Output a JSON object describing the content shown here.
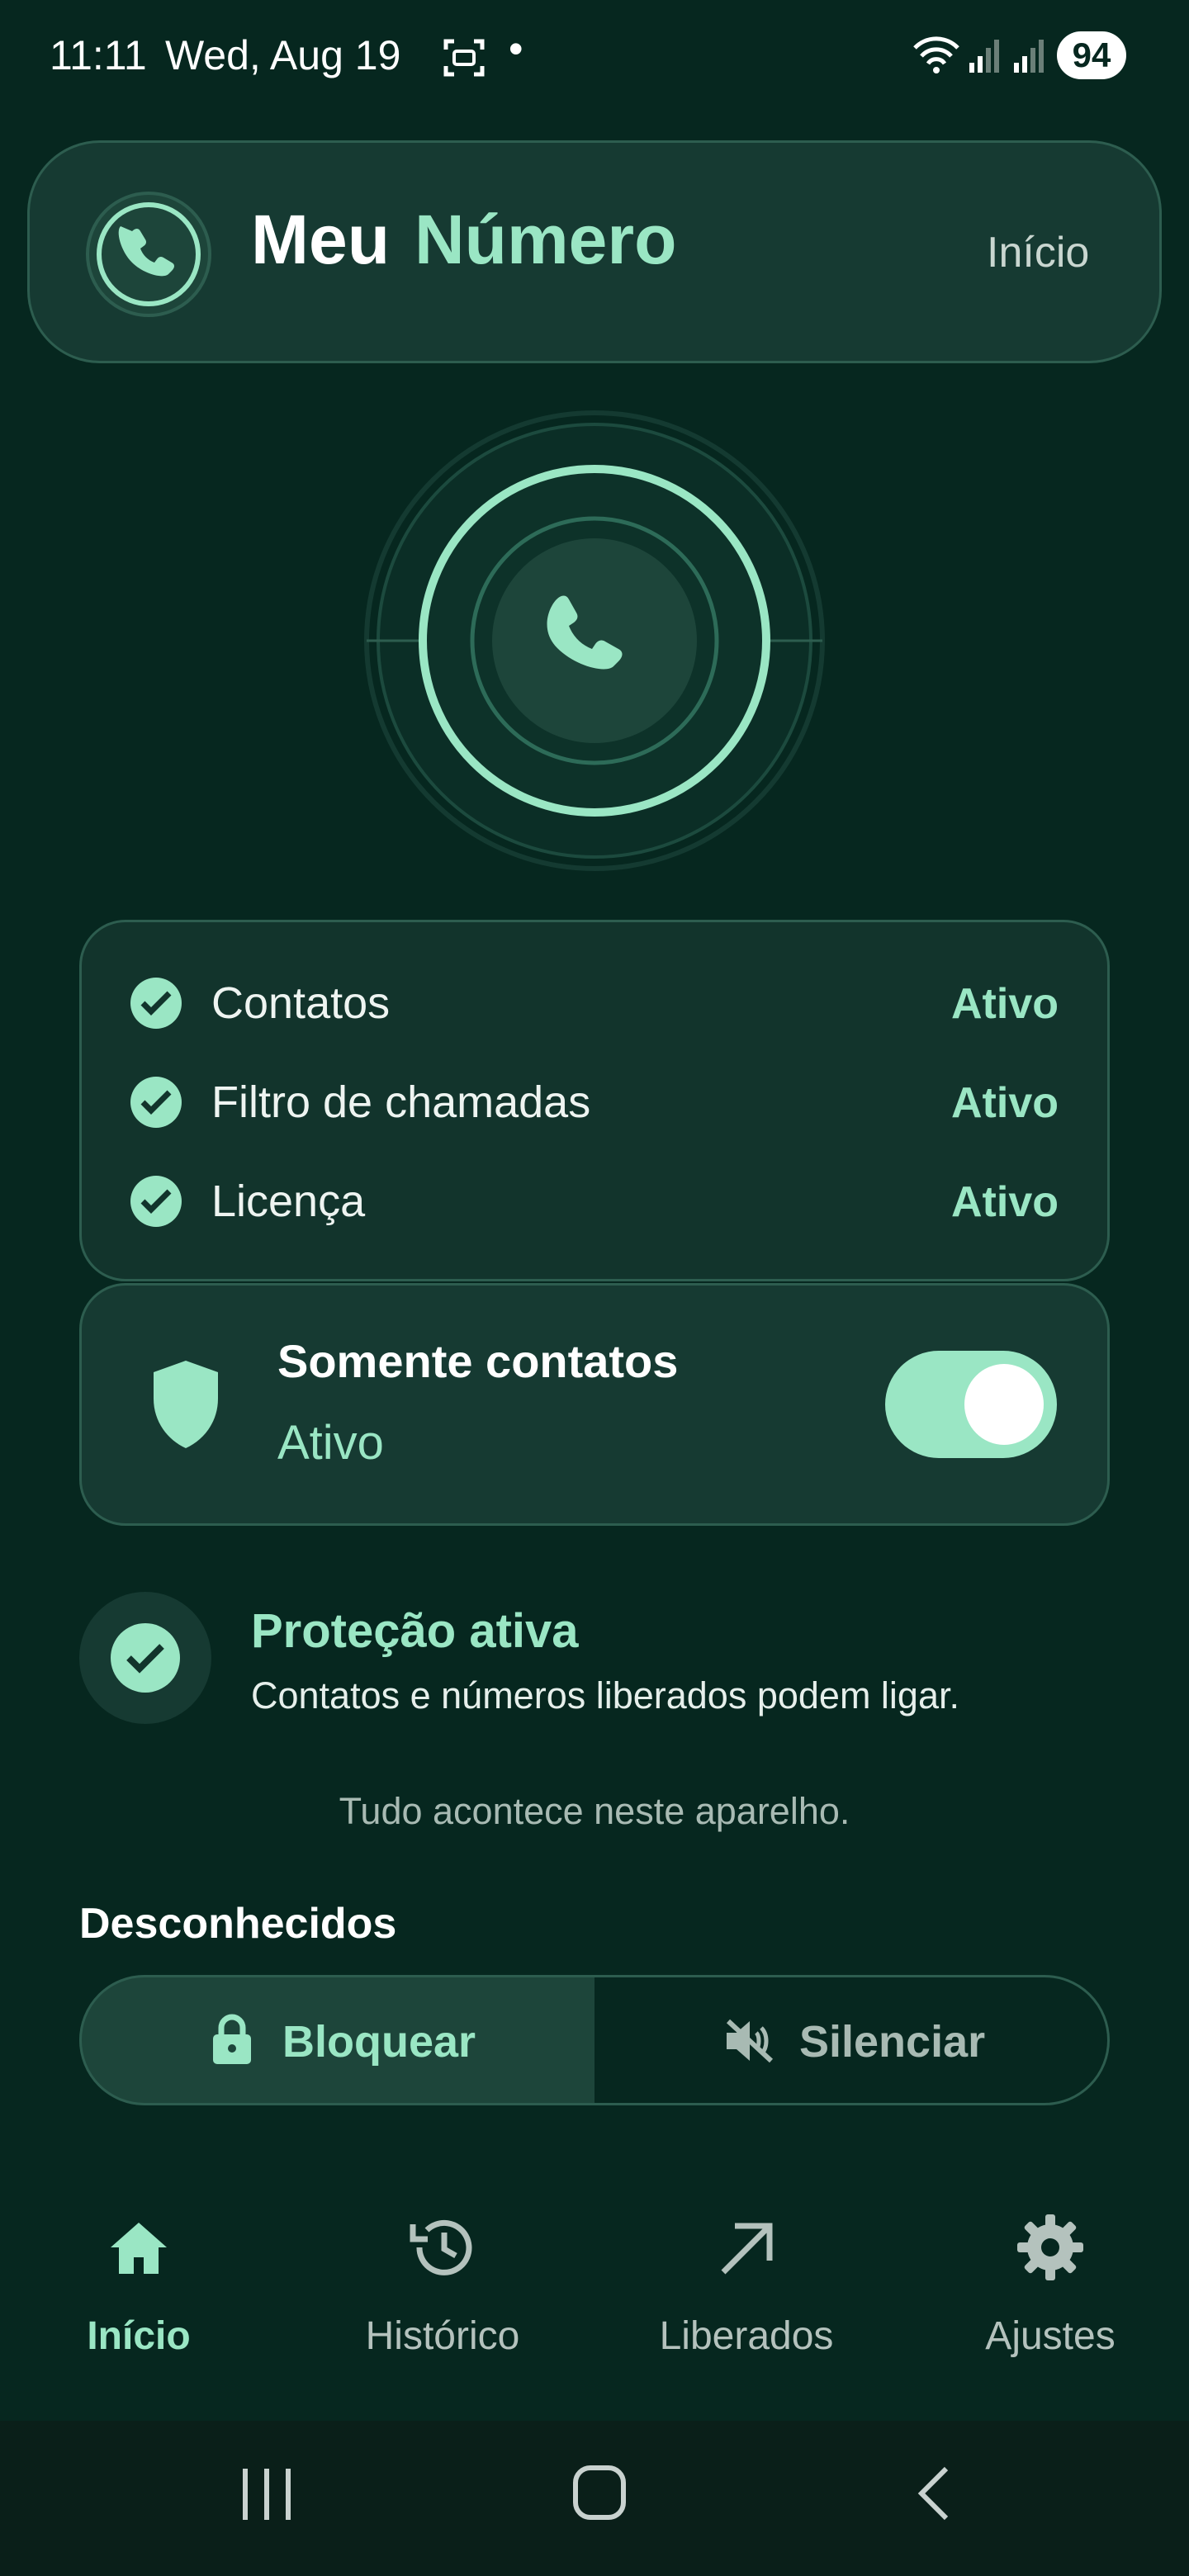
{
  "status_bar": {
    "time": "11:11",
    "date": "Wed, Aug 19",
    "dot": "•",
    "battery": "94"
  },
  "header": {
    "title_part1": "Meu",
    "title_part2": "Número",
    "link": "Início",
    "icon": "phone-icon"
  },
  "hero": {
    "icon": "phone-icon"
  },
  "status_list": [
    {
      "label": "Contatos",
      "status": "Ativo"
    },
    {
      "label": "Filtro de chamadas",
      "status": "Ativo"
    },
    {
      "label": "Licença",
      "status": "Ativo"
    }
  ],
  "contacts_only": {
    "title": "Somente contatos",
    "status": "Ativo",
    "enabled": true,
    "icon": "shield-icon"
  },
  "protection": {
    "title": "Proteção ativa",
    "subtitle": "Contatos e números liberados podem ligar.",
    "icon": "check-icon"
  },
  "note": "Tudo acontece neste aparelho.",
  "unknowns": {
    "heading": "Desconhecidos",
    "options": [
      "Bloquear",
      "Silenciar"
    ],
    "selected": "Bloquear"
  },
  "nav": {
    "items": [
      {
        "label": "Início",
        "icon": "home-icon",
        "active": true
      },
      {
        "label": "Histórico",
        "icon": "history-icon",
        "active": false
      },
      {
        "label": "Liberados",
        "icon": "arrow-up-right-icon",
        "active": false
      },
      {
        "label": "Ajustes",
        "icon": "gear-icon",
        "active": false
      }
    ]
  },
  "colors": {
    "background": "#06271f",
    "accent": "#9ae6c4",
    "card": "#12342c",
    "border": "#2d5d4f"
  }
}
